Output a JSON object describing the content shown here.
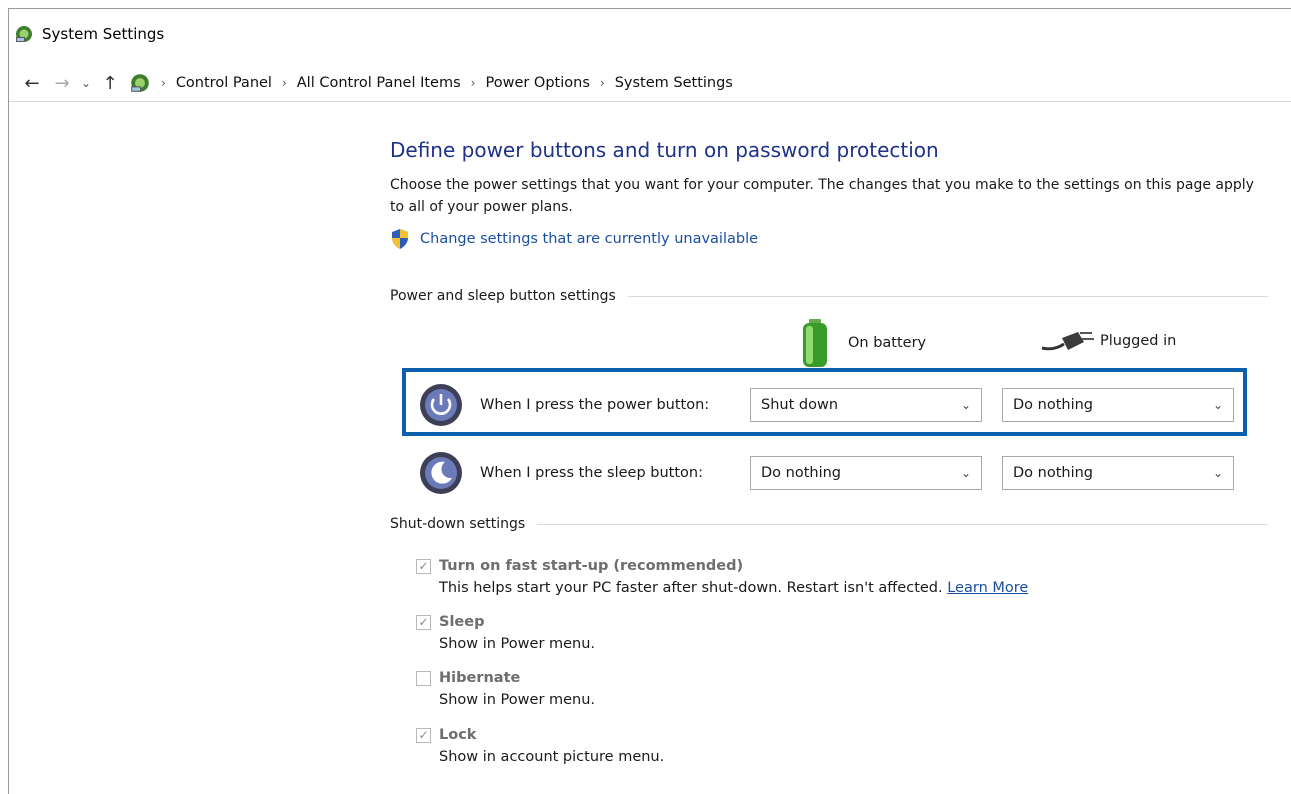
{
  "window": {
    "title": "System Settings"
  },
  "nav": {
    "back_glyph": "←",
    "forward_glyph": "→",
    "recent_glyph": "⌄",
    "up_glyph": "↑",
    "separator": "›",
    "breadcrumb": [
      "Control Panel",
      "All Control Panel Items",
      "Power Options",
      "System Settings"
    ]
  },
  "page": {
    "title": "Define power buttons and turn on password protection",
    "description": "Choose the power settings that you want for your computer. The changes that you make to the settings on this page apply to all of your power plans.",
    "admin_link": "Change settings that are currently unavailable"
  },
  "power_section": {
    "header": "Power and sleep button settings",
    "col_battery": "On battery",
    "col_plugged": "Plugged in",
    "rows": [
      {
        "label": "When I press the power button:",
        "battery": "Shut down",
        "plugged": "Do nothing"
      },
      {
        "label": "When I press the sleep button:",
        "battery": "Do nothing",
        "plugged": "Do nothing"
      }
    ],
    "highlight_color": "#0b5fad"
  },
  "shutdown_section": {
    "header": "Shut-down settings",
    "items": [
      {
        "label": "Turn on fast start-up (recommended)",
        "checked": true,
        "desc": "This helps start your PC faster after shut-down. Restart isn't affected.",
        "link": "Learn More"
      },
      {
        "label": "Sleep",
        "checked": true,
        "desc": "Show in Power menu."
      },
      {
        "label": "Hibernate",
        "checked": false,
        "desc": "Show in Power menu."
      },
      {
        "label": "Lock",
        "checked": true,
        "desc": "Show in account picture menu."
      }
    ]
  },
  "colors": {
    "title_blue": "#1e3287",
    "link_blue": "#1a4fa0",
    "accent_box": "#0b5fad"
  },
  "icons": {
    "app": "control-panel-icon",
    "battery": "battery-icon",
    "plug": "power-plug-icon",
    "power_button": "power-button-icon",
    "sleep_button": "sleep-button-icon",
    "shield": "uac-shield-icon",
    "dropdown": "chevron-down-icon",
    "check": "checkmark-icon"
  }
}
